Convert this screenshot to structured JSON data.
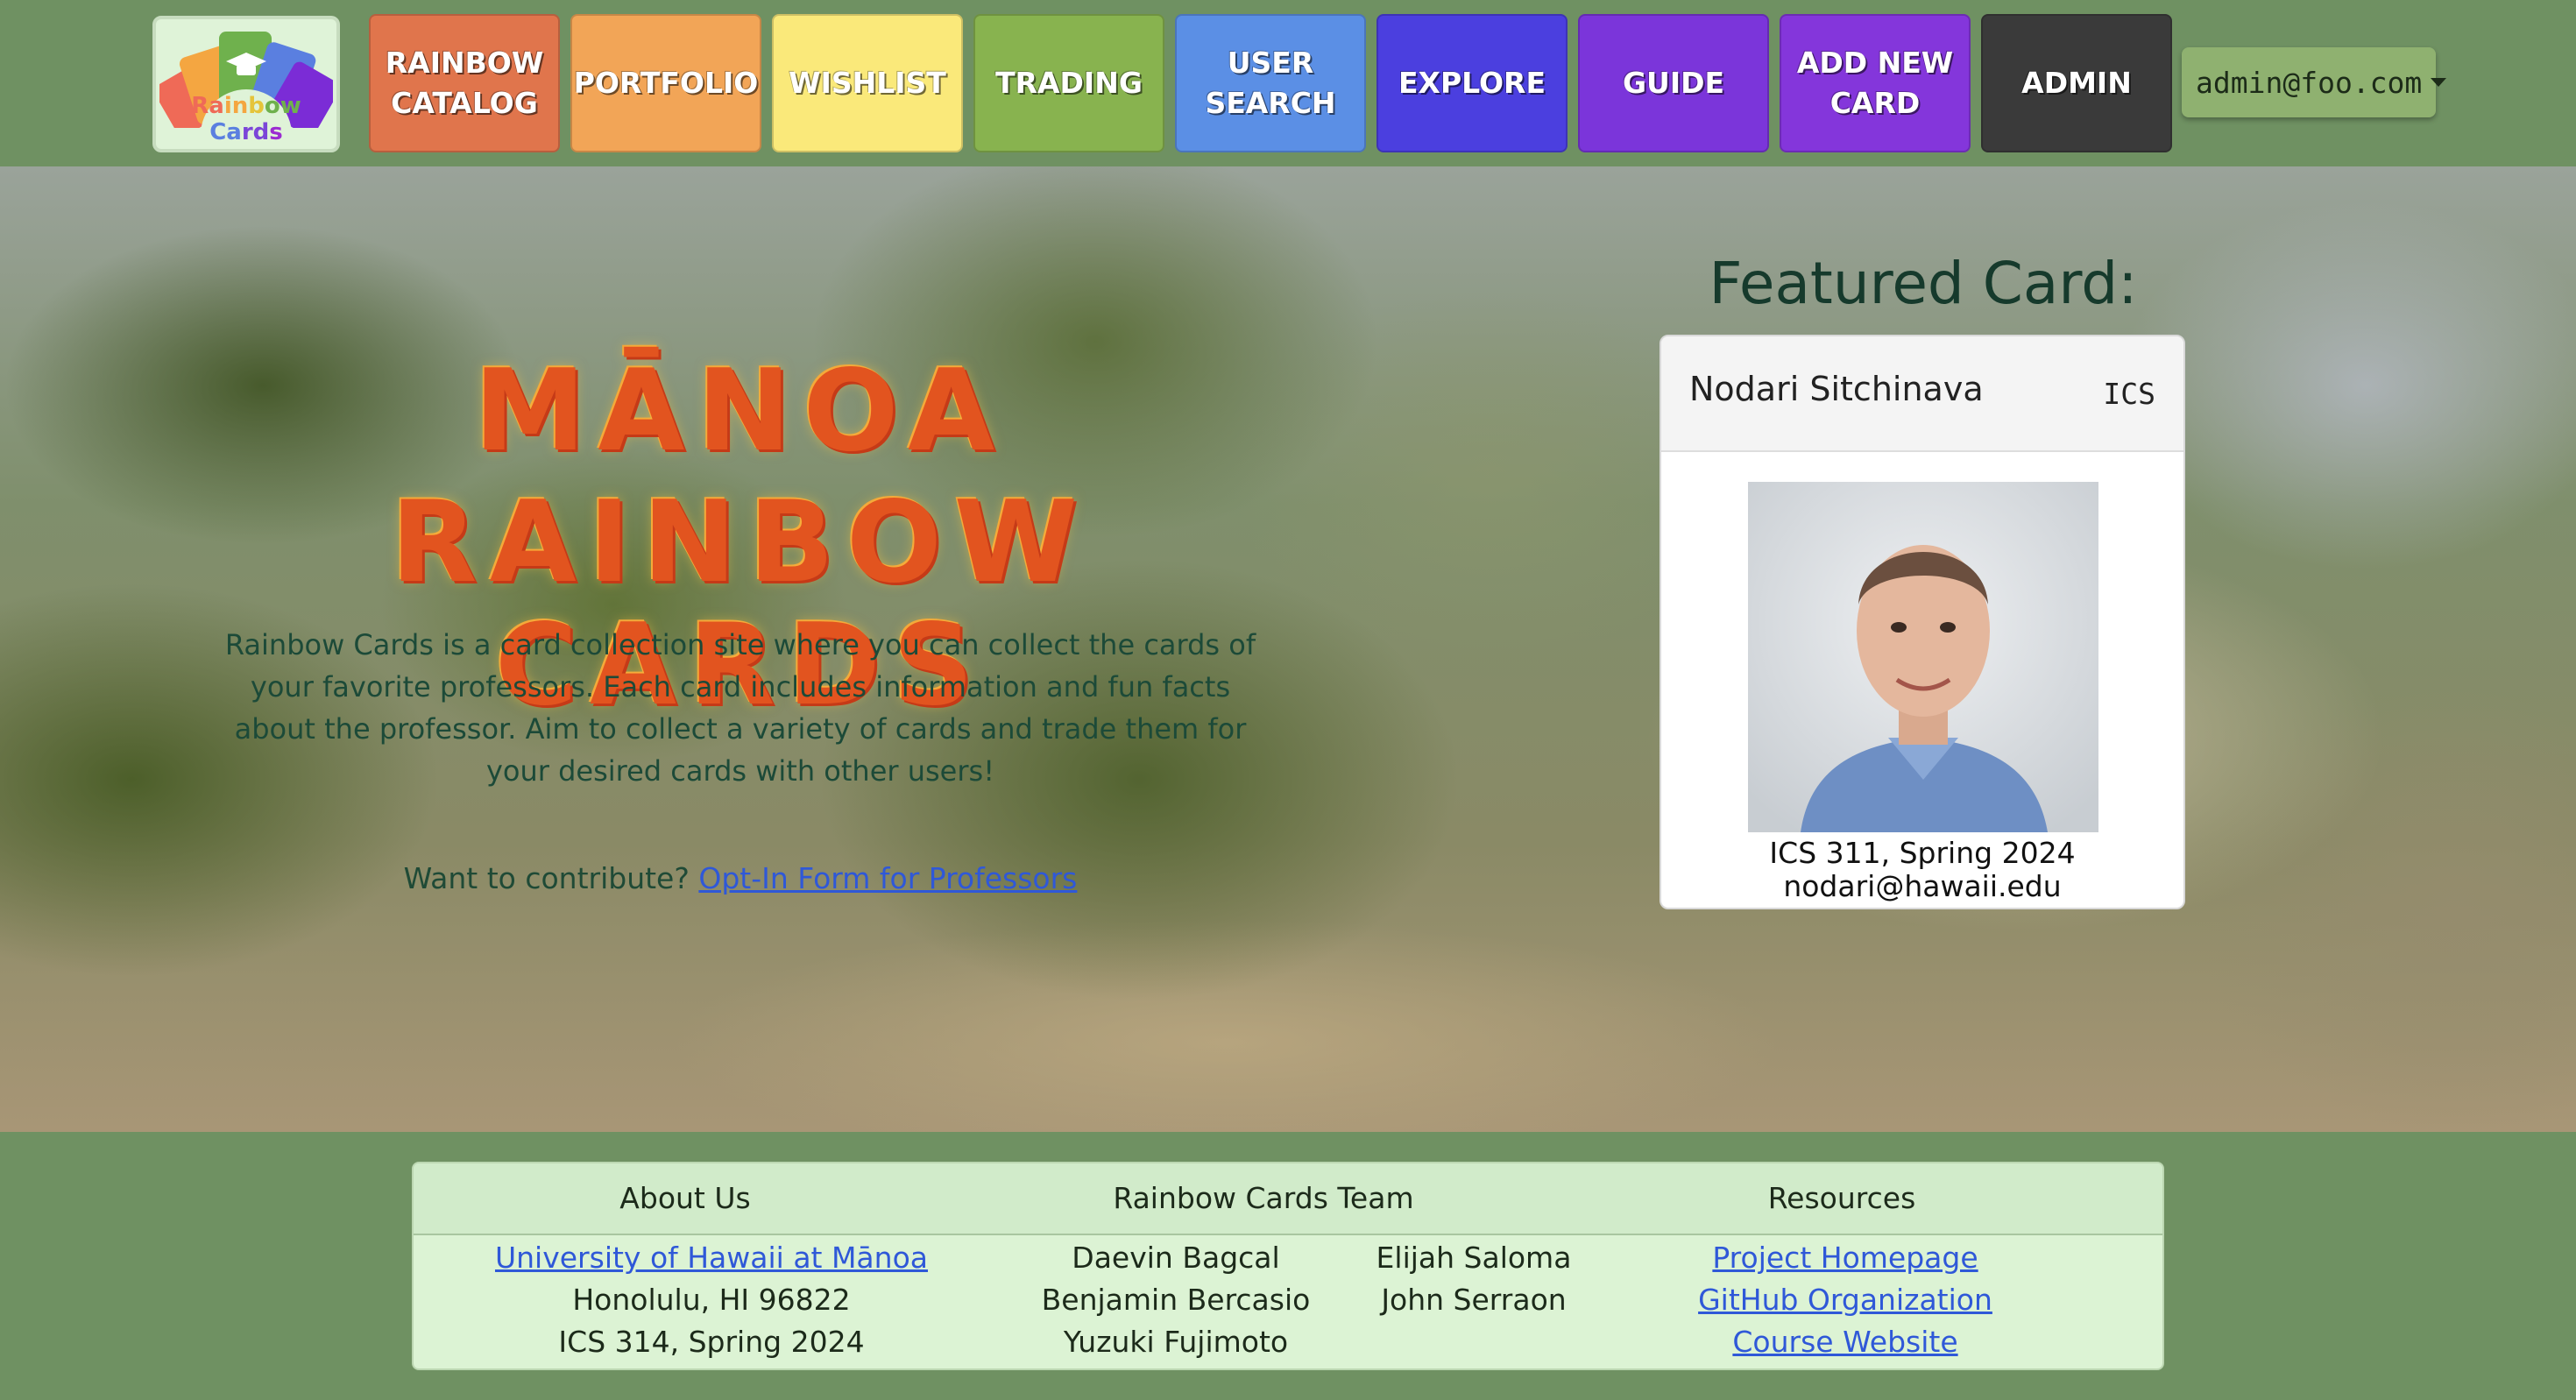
{
  "logo": {
    "text_parts": [
      {
        "t": "Ra",
        "c": "#ef6a57"
      },
      {
        "t": "in",
        "c": "#f4a641"
      },
      {
        "t": "b",
        "c": "#e5c43a"
      },
      {
        "t": "ow ",
        "c": "#6fb14d"
      },
      {
        "t": "Ca",
        "c": "#5a7fe0"
      },
      {
        "t": "rd",
        "c": "#7b46d8"
      },
      {
        "t": "s",
        "c": "#9b2bd1"
      }
    ]
  },
  "nav": {
    "items": [
      {
        "label": "RAINBOW\nCATALOG",
        "color": "#e0754c"
      },
      {
        "label": "PORTFOLIO",
        "color": "#f2a557"
      },
      {
        "label": "WISHLIST",
        "color": "#fae97a"
      },
      {
        "label": "TRADING",
        "color": "#88b34f"
      },
      {
        "label": "USER\nSEARCH",
        "color": "#5b8fe5"
      },
      {
        "label": "EXPLORE",
        "color": "#4b3fdf"
      },
      {
        "label": "GUIDE",
        "color": "#7b35da"
      },
      {
        "label": "ADD NEW\nCARD",
        "color": "#8436db"
      },
      {
        "label": "ADMIN",
        "color": "#3a3a3a"
      }
    ],
    "user": "admin@foo.com"
  },
  "hero": {
    "title_line1": "MĀNOA",
    "title_line2": "RAINBOW CARDS",
    "description": "Rainbow Cards is a card collection site where you can collect the cards of your favorite professors. Each card includes information and fun facts about the professor. Aim to collect a variety of cards and trade them for your desired cards with other users!",
    "cta_text": "Want to contribute?",
    "cta_link": "Opt-In Form for Professors"
  },
  "featured": {
    "title": "Featured Card:",
    "name": "Nodari Sitchinava",
    "dept": "ICS",
    "course": "ICS 311, Spring 2024",
    "email": "nodari@hawaii.edu"
  },
  "footer": {
    "headers": [
      "About Us",
      "Rainbow Cards Team",
      "Resources"
    ],
    "about": {
      "link": "University of Hawaii at Mānoa",
      "line2": "Honolulu, HI 96822",
      "line3": "ICS 314, Spring 2024"
    },
    "team_col1": [
      "Daevin Bagcal",
      "Benjamin Bercasio",
      "Yuzuki Fujimoto"
    ],
    "team_col2": [
      "Elijah Saloma",
      "John Serraon"
    ],
    "resources": [
      "Project Homepage",
      "GitHub Organization",
      "Course Website"
    ]
  }
}
